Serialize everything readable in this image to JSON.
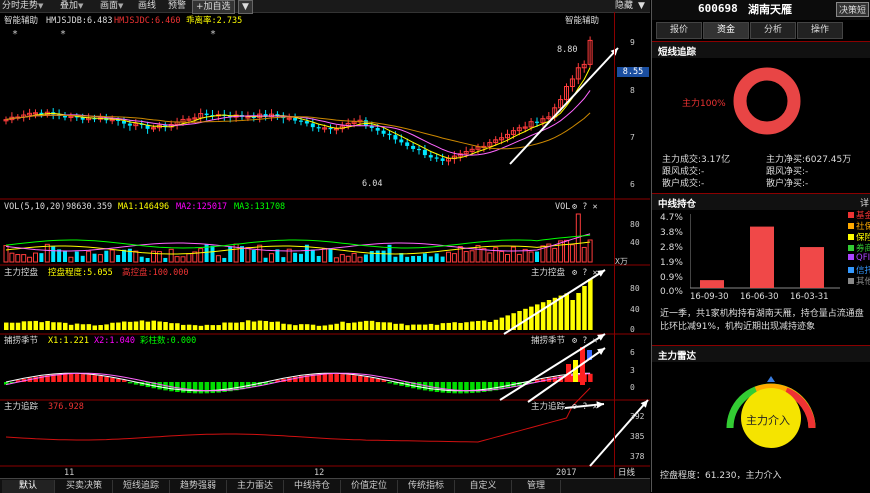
{
  "toolbar": {
    "items": [
      "分时走势",
      "叠加",
      "画面",
      "画线",
      "预警"
    ],
    "add_label": "加自选",
    "hide_label": "隐藏"
  },
  "stock": {
    "code": "600698",
    "name": "湖南天雁",
    "button": "决策短"
  },
  "main_panel": {
    "title": "智能辅助",
    "ind1": "HMJSJDB:6.483",
    "ind2": "HMJSJDC:6.460",
    "ind3": "乖离率:2.735",
    "right_title": "智能辅助",
    "price_current": "8.55",
    "price_high": "8.80",
    "price_low": "6.04",
    "y_labels": [
      "9",
      "8",
      "7",
      "6"
    ]
  },
  "vol_panel": {
    "title": "VOL(5,10,20)",
    "value": "98630.359",
    "ma1": "MA1:146496",
    "ma2": "MA2:125017",
    "ma3": "MA3:131708",
    "right_title": "VOL",
    "unit": "X万",
    "y_labels": [
      "80",
      "40"
    ]
  },
  "control_panel": {
    "title": "主力控盘",
    "level": "控盘程度:5.055",
    "high": "高控盘:100.000",
    "right_title": "主力控盘",
    "y_labels": [
      "80",
      "40",
      "0"
    ]
  },
  "season_panel": {
    "title": "捕捞季节",
    "x1": "X1:1.221",
    "x2": "X2:1.040",
    "cz": "彩柱数:0.000",
    "right_title": "捕捞季节",
    "y_labels": [
      "6",
      "3",
      "0"
    ]
  },
  "trace_panel": {
    "title": "主力追踪",
    "value": "376.928",
    "right_title": "主力追踪",
    "y_labels": [
      "392",
      "385",
      "378"
    ]
  },
  "x_axis": {
    "labels": [
      "11",
      "12",
      "2017"
    ],
    "period": "日线"
  },
  "bottom_tabs": [
    "默认",
    "买卖决策",
    "短线追踪",
    "趋势强弱",
    "主力雷达",
    "中线持仓",
    "价值定位",
    "传统指标",
    "自定义",
    "管理"
  ],
  "right_tabs": [
    "报价",
    "资金",
    "分析",
    "操作"
  ],
  "short_track": {
    "title": "短线追踪",
    "main_pct": "主力100%",
    "rows": [
      [
        "主力成交:3.17亿",
        "主力净买:6027.45万"
      ],
      [
        "跟风成交:-",
        "跟风净买:-"
      ],
      [
        "散户成交:-",
        "散户净买:-"
      ]
    ]
  },
  "mid_hold": {
    "title": "中线持仓",
    "detail": "详",
    "y_labels": [
      "4.7%",
      "3.8%",
      "2.8%",
      "1.9%",
      "0.9%",
      "0.0%"
    ],
    "dates": [
      "16-09-30",
      "16-06-30",
      "16-03-31"
    ],
    "legend": [
      "基金",
      "社保",
      "保险",
      "券商",
      "QFII",
      "信托",
      "其他"
    ],
    "desc": "近一季，共1家机构持有湖南天雁，持仓量占流通盘比环比减91%，机构近期出现减持迹象"
  },
  "radar": {
    "title": "主力雷达",
    "center": "主力介入",
    "level": "控盘程度：61.230，主力介入"
  },
  "chart_data": [
    {
      "type": "bar",
      "title": "主力控盘",
      "x": [
        "16-09-30",
        "16-06-30",
        "16-03-31"
      ],
      "values": [
        0.5,
        3.9,
        2.6
      ]
    }
  ]
}
